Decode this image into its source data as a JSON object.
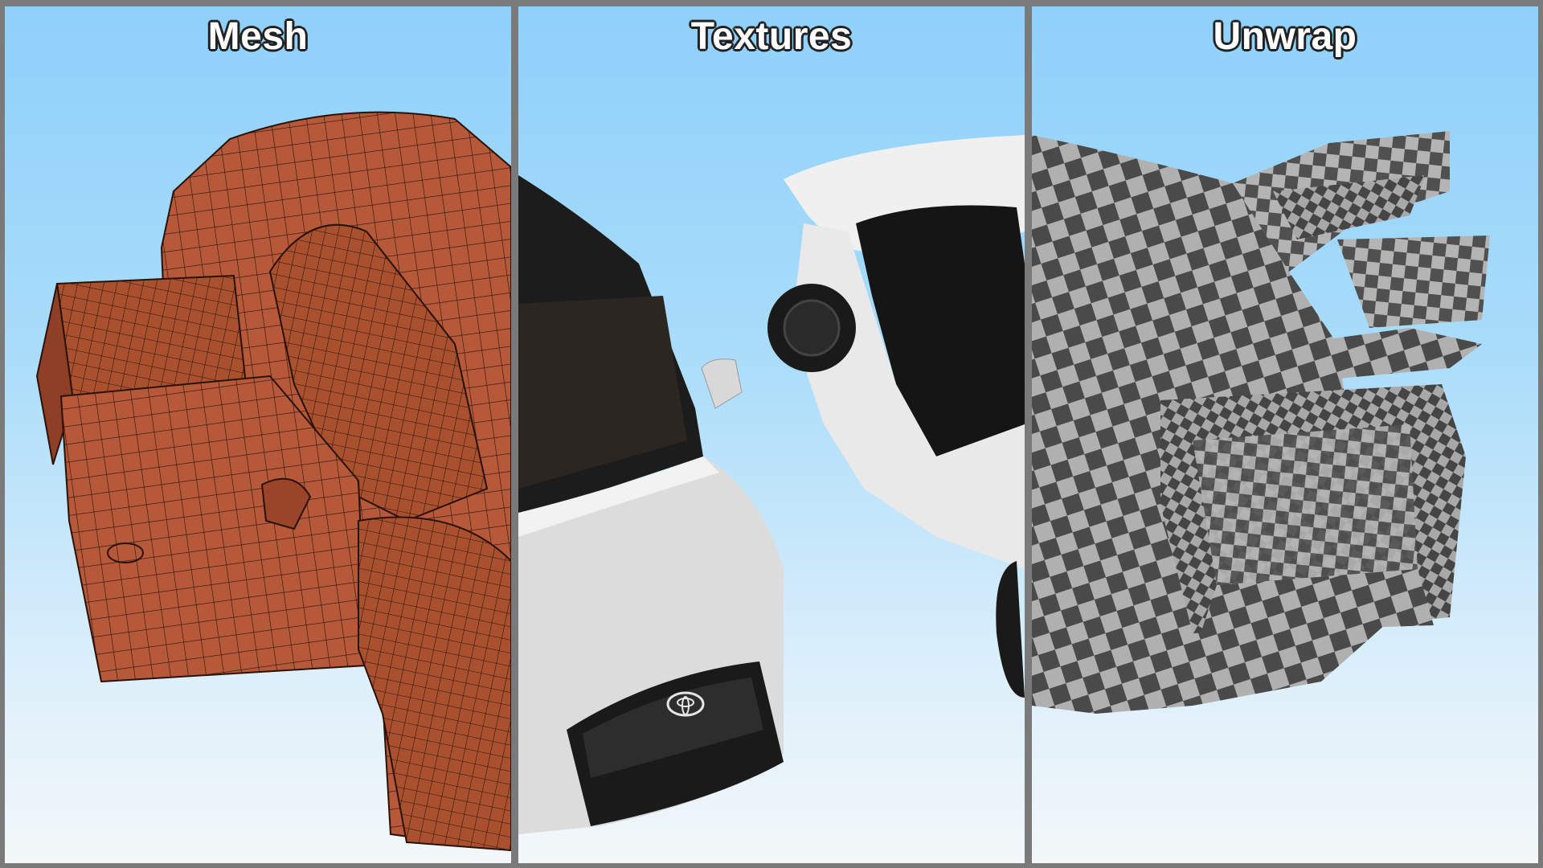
{
  "panels": [
    {
      "title": "Mesh"
    },
    {
      "title": "Textures"
    },
    {
      "title": "Unwrap"
    }
  ],
  "colors": {
    "frame": "#7a7a7a",
    "sky_top": "#8fd0fb",
    "sky_bottom": "#f3f7f9",
    "mesh_fill": "#b5593a",
    "mesh_wire": "#2a1208",
    "car_white": "#e8e8e8",
    "checker_dark": "#4a4a4a",
    "checker_light": "#b0b0b0"
  },
  "icons": [
    "toyota-logo-icon"
  ]
}
